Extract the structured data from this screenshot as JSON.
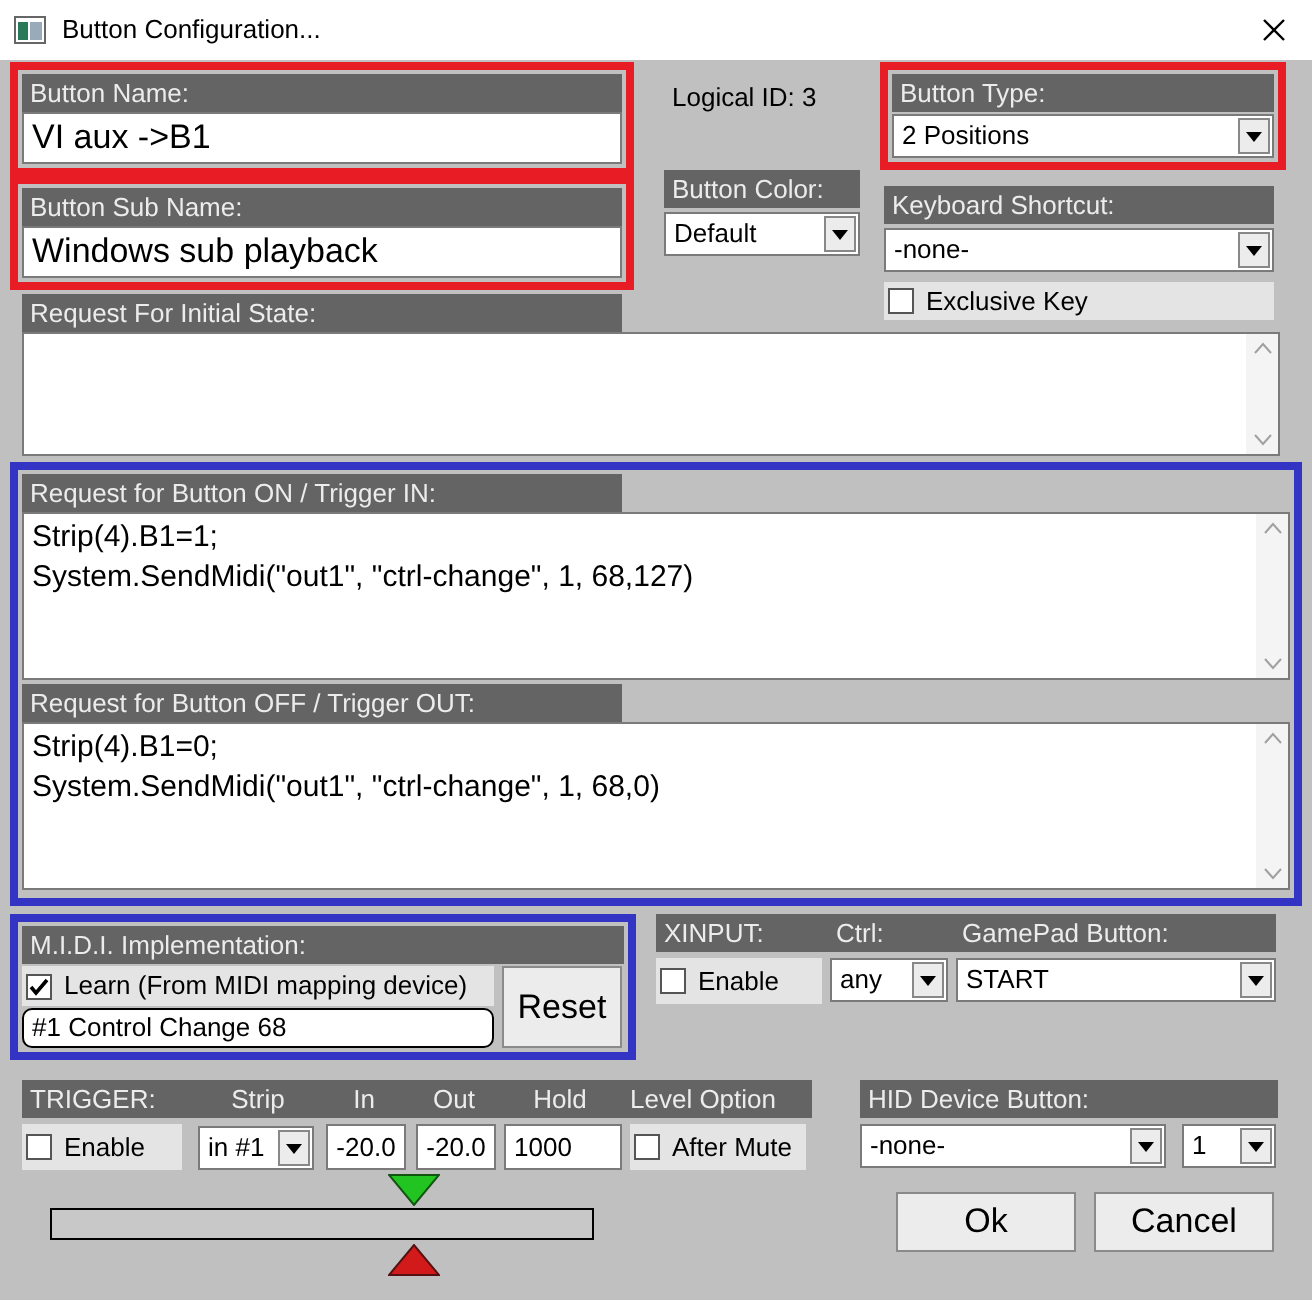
{
  "window": {
    "title": "Button Configuration..."
  },
  "button_name": {
    "label": "Button Name:",
    "value": "VI aux ->B1",
    "color": "#e81c24"
  },
  "button_sub_name": {
    "label": "Button Sub Name:",
    "value": "Windows sub playback",
    "color": "#e81c24"
  },
  "logical_id": "Logical ID: 3",
  "button_type": {
    "label": "Button Type:",
    "value": "2 Positions",
    "color": "#e81c24"
  },
  "button_color": {
    "label": "Button Color:",
    "value": "Default"
  },
  "keyboard_shortcut": {
    "label": "Keyboard Shortcut:",
    "value": "-none-"
  },
  "exclusive_key": {
    "label": "Exclusive Key",
    "checked": false
  },
  "initial_state": {
    "label": "Request For Initial State:"
  },
  "requests": {
    "color": "#3434c4",
    "items": [
      {
        "label": "Request for Button ON / Trigger IN:",
        "lines": [
          "Strip(4).B1=1;",
          "System.SendMidi(\"out1\", \"ctrl-change\", 1, 68,127)"
        ]
      },
      {
        "label": "Request for Button OFF / Trigger OUT:",
        "lines": [
          "Strip(4).B1=0;",
          "System.SendMidi(\"out1\", \"ctrl-change\", 1, 68,0)"
        ]
      }
    ]
  },
  "midi": {
    "label": "M.I.D.I. Implementation:",
    "learn": {
      "label": "Learn (From MIDI mapping device)",
      "checked": true
    },
    "value": "#1 Control Change 68",
    "reset_button": "Reset",
    "color": "#3434c4"
  },
  "xinput": {
    "label": "XINPUT:",
    "enable": {
      "label": "Enable",
      "checked": false
    },
    "ctrl_label": "Ctrl:",
    "ctrl_value": "any",
    "gamepad_label": "GamePad Button:",
    "gamepad_value": "START"
  },
  "trigger": {
    "label": "TRIGGER:",
    "enable": {
      "label": "Enable",
      "checked": false
    },
    "strip_label": "Strip",
    "strip_value": "in #1",
    "in_label": "In",
    "in_value": "-20.0",
    "out_label": "Out",
    "out_value": "-20.0",
    "hold_label": "Hold",
    "hold_value": "1000",
    "level_option_label": "Level Option",
    "after_mute": {
      "label": "After Mute",
      "checked": false
    }
  },
  "hid": {
    "label": "HID Device Button:",
    "device_value": "-none-",
    "number_value": "1"
  },
  "buttons": [
    {
      "label": "Ok"
    },
    {
      "label": "Cancel"
    }
  ]
}
